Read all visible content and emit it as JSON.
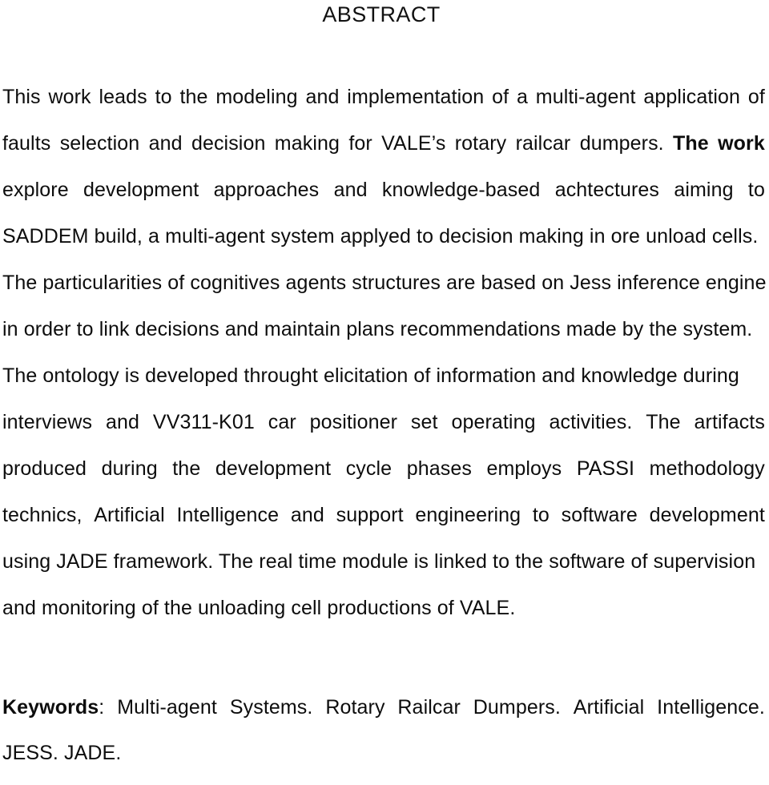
{
  "document": {
    "heading": "ABSTRACT",
    "paragraph_lines": [
      {
        "id": "line-1",
        "text": "This work leads to the modeling and implementation of a multi-agent application of",
        "segments": [
          {
            "text": "This",
            "bold": false
          },
          {
            "text": "work",
            "bold": false
          },
          {
            "text": "leads",
            "bold": false
          },
          {
            "text": "to",
            "bold": false
          },
          {
            "text": "the",
            "bold": false
          },
          {
            "text": "modeling",
            "bold": false
          },
          {
            "text": "and",
            "bold": false
          },
          {
            "text": "implementation",
            "bold": false
          },
          {
            "text": "of",
            "bold": false
          },
          {
            "text": "a",
            "bold": false
          },
          {
            "text": "multi-agent",
            "bold": false
          },
          {
            "text": "application",
            "bold": false
          },
          {
            "text": "of",
            "bold": false
          }
        ]
      },
      {
        "id": "line-2",
        "text": "faults selection and decision making for VALE’s rotary railcar dumpers. The work",
        "segments": [
          {
            "text": "faults",
            "bold": false
          },
          {
            "text": "selection",
            "bold": false
          },
          {
            "text": "and",
            "bold": false
          },
          {
            "text": "decision",
            "bold": false
          },
          {
            "text": "making",
            "bold": false
          },
          {
            "text": "for",
            "bold": false
          },
          {
            "text": "VALE’s",
            "bold": false
          },
          {
            "text": "rotary",
            "bold": false
          },
          {
            "text": "railcar",
            "bold": false
          },
          {
            "text": "dumpers.",
            "bold": false
          },
          {
            "text": "The",
            "bold": true
          },
          {
            "text": "work",
            "bold": true
          }
        ]
      },
      {
        "id": "line-3",
        "text": "explore development approaches and knowledge-based achtectures aiming to",
        "segments": [
          {
            "text": "explore",
            "bold": false
          },
          {
            "text": "development",
            "bold": false
          },
          {
            "text": "approaches",
            "bold": false
          },
          {
            "text": "and",
            "bold": false
          },
          {
            "text": "knowledge-based",
            "bold": false
          },
          {
            "text": "achtectures",
            "bold": false
          },
          {
            "text": "aiming",
            "bold": false
          },
          {
            "text": "to",
            "bold": false
          }
        ]
      },
      {
        "id": "line-4",
        "text": "SADDEM build, a multi-agent system applyed to decision making in ore unload cells.",
        "flow": true
      },
      {
        "id": "line-5",
        "text": "The particularities of cognitives agents structures are based on Jess inference engine",
        "flow": true
      },
      {
        "id": "line-6",
        "text": "in order to link decisions and maintain plans recommendations made by the system.",
        "flow": true
      },
      {
        "id": "line-7",
        "text": "The ontology is developed throught elicitation of information and knowledge during",
        "flow": true
      },
      {
        "id": "line-8",
        "text": "interviews and VV311-K01 car positioner set operating activities. The artifacts",
        "segments": [
          {
            "text": "interviews",
            "bold": false
          },
          {
            "text": "and",
            "bold": false
          },
          {
            "text": "VV311-K01",
            "bold": false
          },
          {
            "text": "car",
            "bold": false
          },
          {
            "text": "positioner",
            "bold": false
          },
          {
            "text": "set",
            "bold": false
          },
          {
            "text": "operating",
            "bold": false
          },
          {
            "text": "activities.",
            "bold": false
          },
          {
            "text": "The",
            "bold": false
          },
          {
            "text": "artifacts",
            "bold": false
          }
        ]
      },
      {
        "id": "line-9",
        "text": "produced during the development cycle phases employs PASSI methodology",
        "segments": [
          {
            "text": "produced",
            "bold": false
          },
          {
            "text": "during",
            "bold": false
          },
          {
            "text": "the",
            "bold": false
          },
          {
            "text": "development",
            "bold": false
          },
          {
            "text": "cycle",
            "bold": false
          },
          {
            "text": "phases",
            "bold": false
          },
          {
            "text": "employs",
            "bold": false
          },
          {
            "text": "PASSI",
            "bold": false
          },
          {
            "text": "methodology",
            "bold": false
          }
        ]
      },
      {
        "id": "line-10",
        "text": "technics, Artificial Intelligence and support engineering to software development",
        "segments": [
          {
            "text": "technics,",
            "bold": false
          },
          {
            "text": "Artificial",
            "bold": false
          },
          {
            "text": "Intelligence",
            "bold": false
          },
          {
            "text": "and",
            "bold": false
          },
          {
            "text": "support",
            "bold": false
          },
          {
            "text": "engineering",
            "bold": false
          },
          {
            "text": "to",
            "bold": false
          },
          {
            "text": "software",
            "bold": false
          },
          {
            "text": "development",
            "bold": false
          }
        ]
      },
      {
        "id": "line-11",
        "text": "using JADE framework. The real time module is linked to the software of supervision",
        "flow": true
      },
      {
        "id": "line-12",
        "text": "and monitoring of the unloading cell productions of VALE.",
        "flow": true
      }
    ],
    "keywords": {
      "label": "Keywords",
      "separator": ":",
      "line_1_items": [
        "Multi-agent",
        "Systems.",
        "Rotary",
        "Railcar",
        "Dumpers.",
        "Artificial",
        "Intelligence."
      ],
      "line_2": "JESS. JADE."
    }
  }
}
